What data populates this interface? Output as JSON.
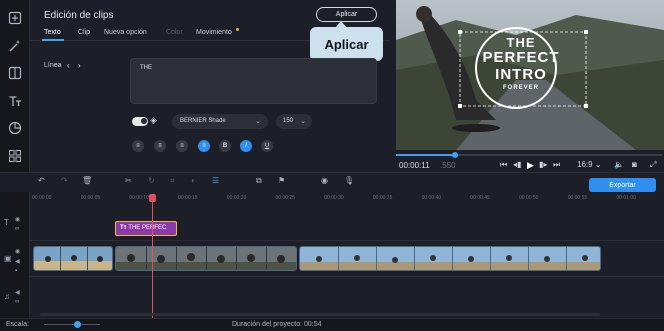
{
  "editor": {
    "title": "Edición de clips",
    "apply_label": "Aplicar",
    "callout_label": "Aplicar",
    "tabs": [
      {
        "label": "Texto",
        "state": "active"
      },
      {
        "label": "Clip",
        "state": "normal"
      },
      {
        "label": "Nueva opción",
        "state": "normal"
      },
      {
        "label": "Color",
        "state": "disabled"
      },
      {
        "label": "Movimiento",
        "state": "normal"
      }
    ],
    "line_label": "Línea",
    "text_value": "THE",
    "font_value": "BERNIER Shade",
    "size_value": "150"
  },
  "preview": {
    "title_line1": "THE",
    "title_line2": "PERFECT",
    "title_line3": "INTRO",
    "title_line4": "FOREVER",
    "time_current": "00:00:11",
    "time_frames": ".550",
    "aspect": "16:9",
    "progress": 0.22
  },
  "toolbar": {
    "export_label": "Exportar"
  },
  "ruler": {
    "ticks": [
      "00:00:00",
      "00:00:05",
      "00:00:10",
      "00:00:15",
      "00:00:20",
      "00:00:25",
      "00:00:30",
      "00:00:35",
      "00:00:40",
      "00:00:45",
      "00:00:50",
      "00:00:55",
      "00:01:00"
    ]
  },
  "timeline": {
    "text_clip_label": "THE PERFEC"
  },
  "status": {
    "scale_label": "Escala:",
    "duration": "Duración del proyecto: 00:54"
  },
  "colors": {
    "accent": "#2f8ff0",
    "playhead": "#e05060",
    "text_clip": "#8a3aa6"
  }
}
